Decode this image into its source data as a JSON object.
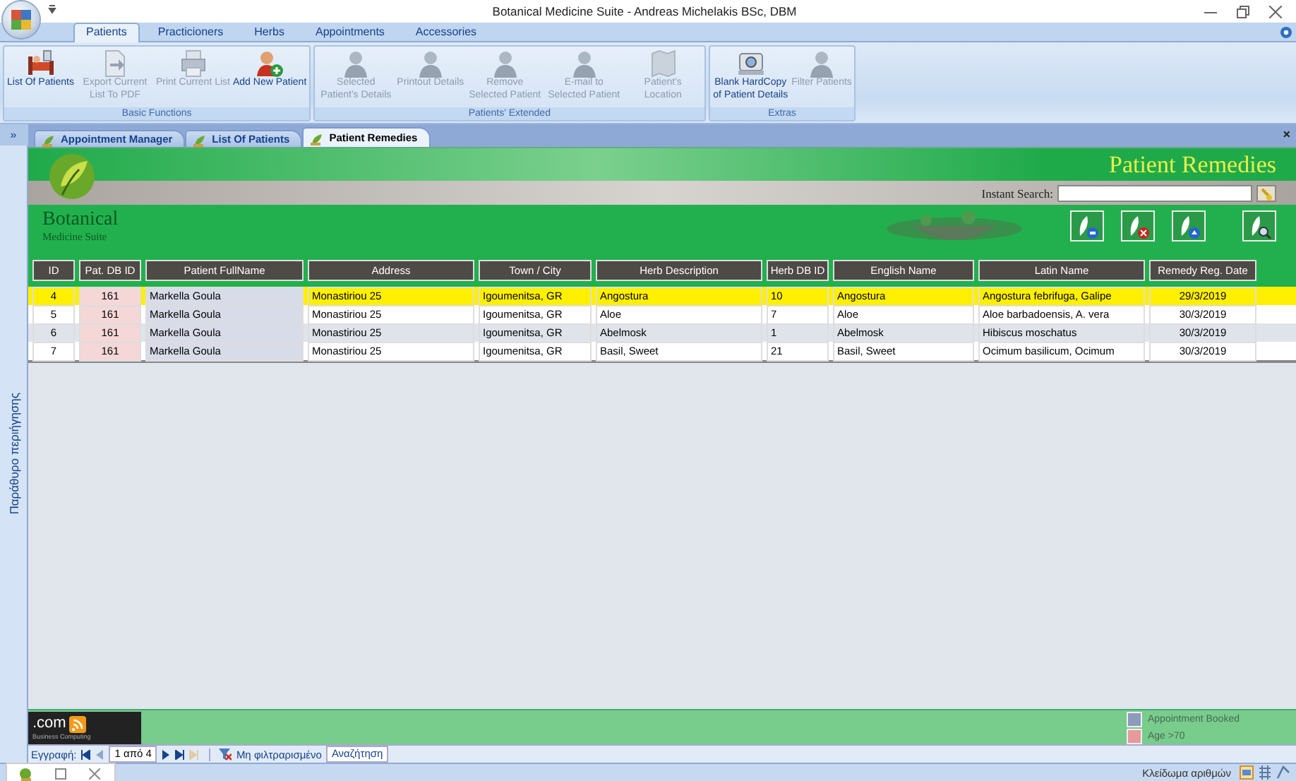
{
  "window": {
    "title": "Botanical Medicine Suite - Andreas Michelakis BSc, DBM"
  },
  "ribbon": {
    "tabs": [
      {
        "label": "Patients",
        "selected": true
      },
      {
        "label": "Practicioners",
        "selected": false
      },
      {
        "label": "Herbs",
        "selected": false
      },
      {
        "label": "Appointments",
        "selected": false
      },
      {
        "label": "Accessories",
        "selected": false
      }
    ],
    "groups": [
      {
        "label": "Basic Functions",
        "buttons": [
          {
            "label": "List Of Patients",
            "disabled": false
          },
          {
            "label": "Export Current List To PDF",
            "disabled": true
          },
          {
            "label": "Print Current List",
            "disabled": true
          },
          {
            "label": "Add New Patient",
            "disabled": false
          }
        ]
      },
      {
        "label": "Patients' Extended",
        "buttons": [
          {
            "label": "Selected Patient's Details",
            "disabled": true
          },
          {
            "label": "Printout Details",
            "disabled": true
          },
          {
            "label": "Remove Selected Patient",
            "disabled": true
          },
          {
            "label": "E-mail to Selected Patient",
            "disabled": true
          },
          {
            "label": "Patient's Location",
            "disabled": true
          }
        ]
      },
      {
        "label": "Extras",
        "buttons": [
          {
            "label": "Blank HardCopy of Patient Details",
            "disabled": false
          },
          {
            "label": "Filter Patients",
            "disabled": true
          }
        ]
      }
    ]
  },
  "navigation_pane": {
    "toggle": "»",
    "label": "Παράθυρο περιήγησης"
  },
  "doc_tabs": [
    {
      "label": "Appointment Manager",
      "selected": false
    },
    {
      "label": "List Of Patients",
      "selected": false
    },
    {
      "label": "Patient Remedies",
      "selected": true
    }
  ],
  "doc_close": "×",
  "form": {
    "brand": "Botanical",
    "brand_sub": "Medicine Suite",
    "title": "Patient Remedies",
    "search_label": "Instant Search:",
    "table": {
      "columns": [
        "ID",
        "Pat. DB ID",
        "Patient FullName",
        "Address",
        "Town / City",
        "Herb Description",
        "Herb DB ID",
        "English Name",
        "Latin Name",
        "Remedy Reg. Date"
      ],
      "rows": [
        {
          "cells": [
            "4",
            "161",
            "Markella Goula",
            "Monastiriou 25",
            "Igoumenitsa, GR",
            "Angostura",
            "10",
            "Angostura",
            "Angostura febrifuga, Galipe",
            "29/3/2019"
          ],
          "selected": true,
          "age_over_70": true,
          "appointment_booked": true
        },
        {
          "cells": [
            "5",
            "161",
            "Markella Goula",
            "Monastiriou 25",
            "Igoumenitsa, GR",
            "Aloe",
            "7",
            "Aloe",
            "Aloe barbadoensis, A. vera",
            "30/3/2019"
          ],
          "selected": false,
          "age_over_70": true,
          "appointment_booked": true
        },
        {
          "cells": [
            "6",
            "161",
            "Markella Goula",
            "Monastiriou 25",
            "Igoumenitsa, GR",
            "Abelmosk",
            "1",
            "Abelmosk",
            "Hibiscus moschatus",
            "30/3/2019"
          ],
          "selected": false,
          "age_over_70": true,
          "appointment_booked": true
        },
        {
          "cells": [
            "7",
            "161",
            "Markella Goula",
            "Monastiriou 25",
            "Igoumenitsa, GR",
            "Basil, Sweet",
            "21",
            "Basil, Sweet",
            "Ocimum basilicum, Ocimum",
            "30/3/2019"
          ],
          "selected": false,
          "age_over_70": true,
          "appointment_booked": true
        }
      ]
    },
    "footer_logo": ".com",
    "footer_logo_sub": "Business Computing",
    "legend": [
      {
        "label": "Appointment Booked",
        "color": "#8f9bbd"
      },
      {
        "label": "Age >70",
        "color": "#e79a9e"
      }
    ]
  },
  "record_nav": {
    "label": "Εγγραφή:",
    "position": "1 από 4",
    "filter": "Μη φιλτραρισμένο",
    "search": "Αναζήτηση"
  },
  "status_bar": {
    "text": "Κλείδωμα αριθμών"
  }
}
